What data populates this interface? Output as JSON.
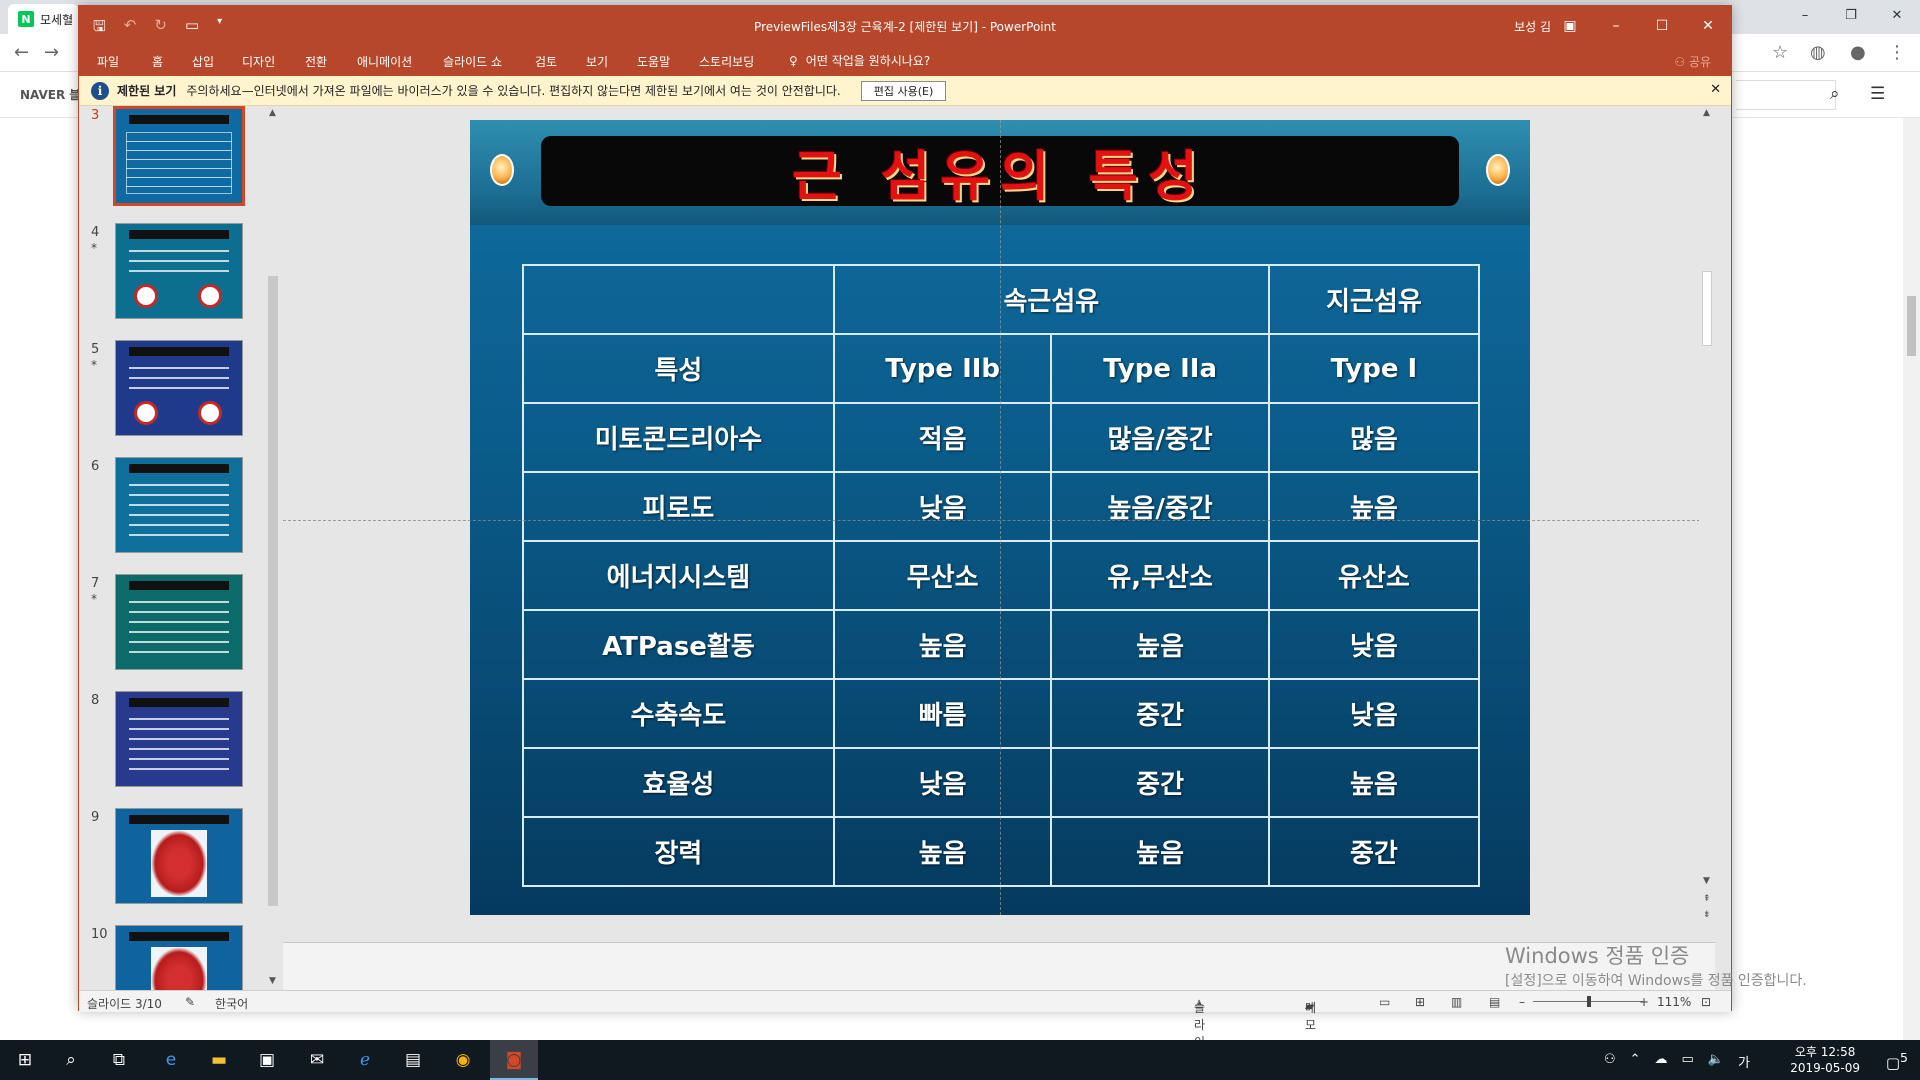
{
  "browser": {
    "tab_label": "모세혈",
    "naver_label": "NAVER 블"
  },
  "window": {
    "title": "PreviewFiles제3장 근육계-2 [제한된 보기] - PowerPoint",
    "user": "보성 김",
    "share": "공유"
  },
  "ribbon": {
    "tabs": [
      "파일",
      "홈",
      "삽입",
      "디자인",
      "전환",
      "애니메이션",
      "슬라이드 쇼",
      "검토",
      "보기",
      "도움말",
      "스토리보딩"
    ],
    "tell_me": "어떤 작업을 원하시나요?"
  },
  "message_bar": {
    "title": "제한된 보기",
    "text": "주의하세요—인터넷에서 가져온 파일에는 바이러스가 있을 수 있습니다. 편집하지 않는다면 제한된 보기에서 여는 것이 안전합니다.",
    "button": "편집 사용(E)"
  },
  "thumbnails": [
    {
      "num": "3",
      "star": false,
      "selected": true,
      "color": "#0e6aa1",
      "style": "table"
    },
    {
      "num": "4",
      "star": true,
      "selected": false,
      "color": "#0c6f8f",
      "style": "discs"
    },
    {
      "num": "5",
      "star": true,
      "selected": false,
      "color": "#1f3a8a",
      "style": "discs"
    },
    {
      "num": "6",
      "star": false,
      "selected": false,
      "color": "#0d6f9a",
      "style": "lines"
    },
    {
      "num": "7",
      "star": true,
      "selected": false,
      "color": "#0b6a6a",
      "style": "lines"
    },
    {
      "num": "8",
      "star": false,
      "selected": false,
      "color": "#273a8e",
      "style": "lines"
    },
    {
      "num": "9",
      "star": false,
      "selected": false,
      "color": "#0f64a0",
      "style": "figure"
    },
    {
      "num": "10",
      "star": false,
      "selected": false,
      "color": "#0f64a0",
      "style": "figure"
    }
  ],
  "slide": {
    "title": "근 섬유의 특성",
    "table": {
      "group_headers": {
        "fast": "속근섬유",
        "slow": "지근섬유"
      },
      "col_headers": [
        "특성",
        "Type IIb",
        "Type IIa",
        "Type I"
      ],
      "rows": [
        [
          "미토콘드리아수",
          "적음",
          "많음/중간",
          "많음"
        ],
        [
          "피로도",
          "낮음",
          "높음/중간",
          "높음"
        ],
        [
          "에너지시스템",
          "무산소",
          "유,무산소",
          "유산소"
        ],
        [
          "ATPase활동",
          "높음",
          "높음",
          "낮음"
        ],
        [
          "수축속도",
          "빠름",
          "중간",
          "낮음"
        ],
        [
          "효율성",
          "낮음",
          "중간",
          "높음"
        ],
        [
          "장력",
          "높음",
          "높음",
          "중간"
        ]
      ]
    }
  },
  "status": {
    "slide_pos": "슬라이드 3/10",
    "language": "한국어",
    "notes": "슬라이드 노트",
    "comments": "메모",
    "zoom": "111%"
  },
  "watermark": {
    "title": "Windows 정품 인증",
    "subtitle": "[설정]으로 이동하여 Windows를 정품 인증합니다."
  },
  "taskbar": {
    "time": "오후 12:58",
    "date": "2019-05-09",
    "ime": "가",
    "notifications": "5"
  }
}
